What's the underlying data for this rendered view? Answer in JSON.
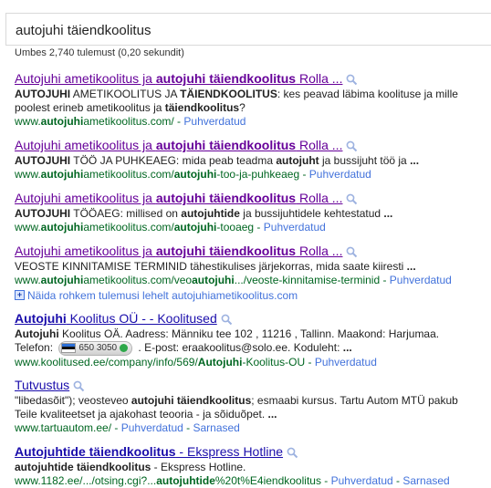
{
  "search": {
    "query": "autojuhi täiendkoolitus"
  },
  "stats": "Umbes 2,740 tulemust (0,20 sekundit)",
  "results": [
    {
      "title_parts": [
        [
          "Autojuhi ametikoolitus ja ",
          false
        ],
        [
          "autojuhi täiendkoolitus",
          true
        ],
        [
          " Rolla ...",
          false
        ]
      ],
      "snippet_lines": [
        [
          [
            "AUTOJUHI",
            true
          ],
          [
            " AMETIKOOLITUS JA ",
            false
          ],
          [
            "TÄIENDKOOLITUS",
            true
          ],
          [
            ": kes peavad läbima koolituse ja mille",
            false
          ]
        ],
        [
          [
            "poolest erineb ametikoolitus ja ",
            false
          ],
          [
            "täiendkoolitus",
            true
          ],
          [
            "?",
            false
          ]
        ]
      ],
      "url_parts": [
        [
          "www.",
          false
        ],
        [
          "autojuhi",
          true
        ],
        [
          "ametikoolitus.com/",
          false
        ]
      ],
      "links": [
        "Puhverdatud"
      ]
    },
    {
      "title_parts": [
        [
          "Autojuhi ametikoolitus ja ",
          false
        ],
        [
          "autojuhi täiendkoolitus",
          true
        ],
        [
          " Rolla ...",
          false
        ]
      ],
      "snippet_lines": [
        [
          [
            "AUTOJUHI",
            true
          ],
          [
            " TÖÖ JA PUHKEAEG: mida peab teadma ",
            false
          ],
          [
            "autojuht",
            true
          ],
          [
            " ja bussijuht töö ja ",
            false
          ],
          [
            "...",
            true
          ]
        ]
      ],
      "url_parts": [
        [
          "www.",
          false
        ],
        [
          "autojuhi",
          true
        ],
        [
          "ametikoolitus.com/",
          false
        ],
        [
          "autojuhi",
          true
        ],
        [
          "-too-ja-puhkeaeg",
          false
        ]
      ],
      "links": [
        "Puhverdatud"
      ]
    },
    {
      "title_parts": [
        [
          "Autojuhi ametikoolitus ja ",
          false
        ],
        [
          "autojuhi täiendkoolitus",
          true
        ],
        [
          " Rolla ...",
          false
        ]
      ],
      "snippet_lines": [
        [
          [
            "AUTOJUHI",
            true
          ],
          [
            " TÖÖAEG: millised on ",
            false
          ],
          [
            "autojuhtide",
            true
          ],
          [
            " ja bussijuhtidele kehtestatud ",
            false
          ],
          [
            "...",
            true
          ]
        ]
      ],
      "url_parts": [
        [
          "www.",
          false
        ],
        [
          "autojuhi",
          true
        ],
        [
          "ametikoolitus.com/",
          false
        ],
        [
          "autojuhi",
          true
        ],
        [
          "-tooaeg",
          false
        ]
      ],
      "links": [
        "Puhverdatud"
      ]
    },
    {
      "title_parts": [
        [
          "Autojuhi ametikoolitus ja ",
          false
        ],
        [
          "autojuhi täiendkoolitus",
          true
        ],
        [
          " Rolla ...",
          false
        ]
      ],
      "snippet_lines": [
        [
          [
            "VEOSTE KINNITAMISE TERMINID tähestikulises järjekorras, mida saate kiiresti ",
            false
          ],
          [
            "...",
            true
          ]
        ]
      ],
      "url_parts": [
        [
          "www.",
          false
        ],
        [
          "autojuhi",
          true
        ],
        [
          "ametikoolitus.com/veo",
          false
        ],
        [
          "autojuhi",
          true
        ],
        [
          ".../veoste-kinnitamise-terminid",
          false
        ]
      ],
      "links": [
        "Puhverdatud"
      ]
    }
  ],
  "more_results": "Näida rohkem tulemusi lehelt autojuhiametikoolitus.com",
  "koolitused": {
    "title_parts": [
      [
        "Autojuhi",
        true
      ],
      [
        " Koolitus OÜ - - Koolitused",
        false
      ]
    ],
    "line1": [
      [
        "Autojuhi",
        true
      ],
      [
        " Koolitus OÄ. Aadress: Männiku tee 102 , 11216 , Tallinn. Maakond: Harjumaa.",
        false
      ]
    ],
    "telefon_label": "Telefon: ",
    "phone": "650 3050",
    "line2_rest": [
      [
        " . E-post: eraakoolitus@solo.ee. Koduleht: ",
        false
      ],
      [
        "...",
        true
      ]
    ],
    "url_parts": [
      [
        "www.koolitused.ee/company/info/569/",
        false
      ],
      [
        "Autojuhi",
        true
      ],
      [
        "-Koolitus-OU",
        false
      ]
    ],
    "links": [
      "Puhverdatud"
    ]
  },
  "tutvustus": {
    "title": "Tutvustus",
    "snippet_lines": [
      [
        [
          "\"libedasõit\"); veosteveo ",
          false
        ],
        [
          "autojuhi täiendkoolitus",
          true
        ],
        [
          "; esmaabi kursus. Tartu Autom MTÜ pakub",
          false
        ]
      ],
      [
        [
          "Teile kvaliteetset ja ajakohast teooria - ja sõiduõpet. ",
          false
        ],
        [
          "...",
          true
        ]
      ]
    ],
    "url": "www.tartuautom.ee/",
    "links": [
      "Puhverdatud",
      "Sarnased"
    ]
  },
  "hotline": {
    "title_parts": [
      [
        "Autojuhtide täiendkoolitus",
        true
      ],
      [
        " - Ekspress Hotline",
        false
      ]
    ],
    "snippet_lines": [
      [
        [
          "autojuhtide täiendkoolitus",
          true
        ],
        [
          " - Ekspress Hotline.",
          false
        ]
      ]
    ],
    "url_parts": [
      [
        "www.1182.ee/.../otsing.cgi?...",
        false
      ],
      [
        "autojuhtide",
        true
      ],
      [
        "%20t%E4iendkoolitus",
        false
      ]
    ],
    "links": [
      "Puhverdatud",
      "Sarnased"
    ]
  }
}
